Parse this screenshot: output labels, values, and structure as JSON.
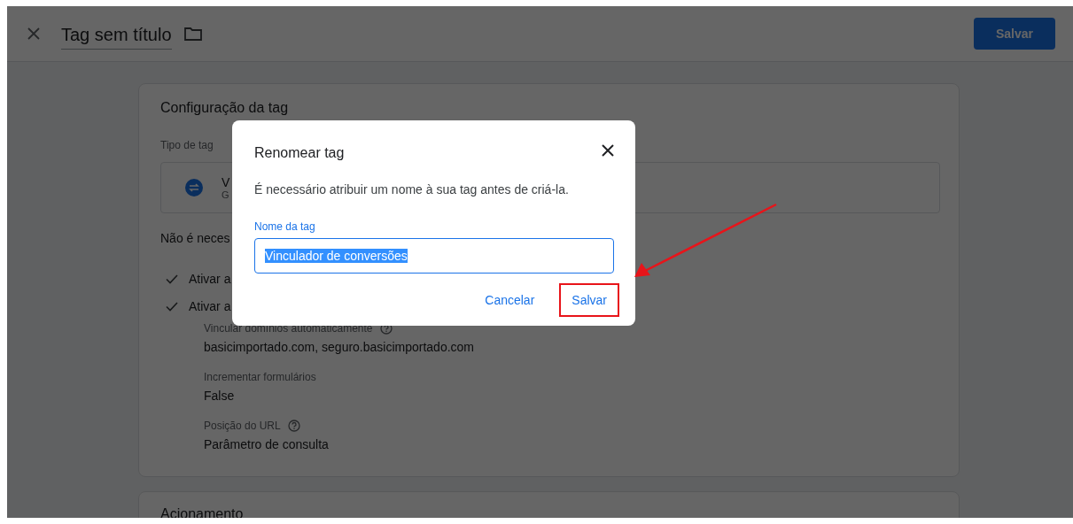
{
  "header": {
    "title": "Tag sem título",
    "save_button": "Salvar"
  },
  "tag_config": {
    "title": "Configuração da tag",
    "type_label": "Tipo de tag",
    "type_name": "V",
    "type_subtitle": "G",
    "note": "Não é neces",
    "options": [
      {
        "label": "Ativar a",
        "checked": true
      },
      {
        "label": "Ativar a",
        "checked": true
      }
    ],
    "fields": [
      {
        "label": "Vincular domínios automaticamente",
        "help": true,
        "value": "basicimportado.com, seguro.basicimportado.com"
      },
      {
        "label": "Incrementar formulários",
        "help": false,
        "value": "False"
      },
      {
        "label": "Posição do URL",
        "help": true,
        "value": "Parâmetro de consulta"
      }
    ]
  },
  "triggering": {
    "title": "Acionamento"
  },
  "dialog": {
    "title": "Renomear tag",
    "message": "É necessário atribuir um nome à sua tag antes de criá-la.",
    "field": {
      "label": "Nome da tag",
      "value": "Vinculador de conversões",
      "text_selected": true
    },
    "cancel_button": "Cancelar",
    "save_button": "Salvar"
  }
}
